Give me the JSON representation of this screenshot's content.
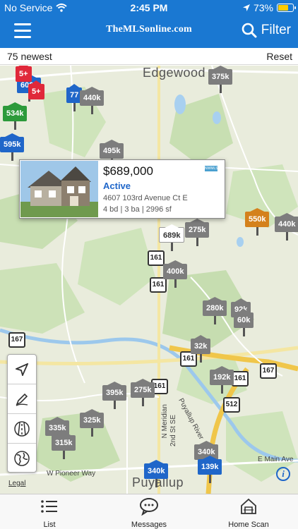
{
  "status_bar": {
    "carrier": "No Service",
    "time": "2:45 PM",
    "battery": "73%",
    "battery_level": 0.73,
    "battery_color": "#ffcc00"
  },
  "nav": {
    "brand": "TheMLSonline.com",
    "filter_label": "Filter",
    "bar_color": "#1a78d2"
  },
  "subbar": {
    "count_label": "75 newest",
    "reset_label": "Reset"
  },
  "map": {
    "place_names": {
      "edgewood": "Edgewood",
      "puyallup": "Puyallup"
    },
    "streets": {
      "w_pioneer": "W Pioneer Way",
      "n_meridian": "N Meridian",
      "second_st": "2nd St SE",
      "puyallup_river": "Puyallup River",
      "e_main": "E Main Ave"
    },
    "markers": {
      "m_375k": "375k",
      "m_600k": "600k",
      "m_5plus_a": "5+",
      "m_5plus_b": "5+",
      "m_534k": "534k",
      "m_77": "77",
      "m_440k_a": "440k",
      "m_595k": "595k",
      "m_495k": "495k",
      "m_550k": "550k",
      "m_440k_b": "440k",
      "m_689k": "689k",
      "m_275k_a": "275k",
      "m_400k": "400k",
      "m_280k": "280k",
      "m_92k": "92k",
      "m_60k": "60k",
      "m_32k": "32k",
      "m_192k": "192k",
      "m_395k": "395k",
      "m_275k_b": "275k",
      "m_325k": "325k",
      "m_335k": "335k",
      "m_315k": "315k",
      "m_340k": "340k",
      "m_139k": "139k",
      "m_340k_b": "340k"
    },
    "shields": {
      "s161_a": "161",
      "s161_b": "161",
      "s167_a": "167",
      "s167_b": "167",
      "s161_c": "161",
      "s161_d": "161",
      "s512": "512",
      "s161_e": "161"
    },
    "legal_label": "Legal",
    "info_label": "i"
  },
  "listing_popup": {
    "price": "$689,000",
    "status": "Active",
    "address": "4607 103rd Avenue Ct E",
    "details": "4 bd | 3 ba | 2996 sf",
    "logo_text": "NWMLS"
  },
  "map_tools": [
    "locate-icon",
    "draw-icon",
    "road-icon",
    "globe-icon"
  ],
  "tabs": {
    "list": "List",
    "messages": "Messages",
    "home_scan": "Home Scan"
  }
}
